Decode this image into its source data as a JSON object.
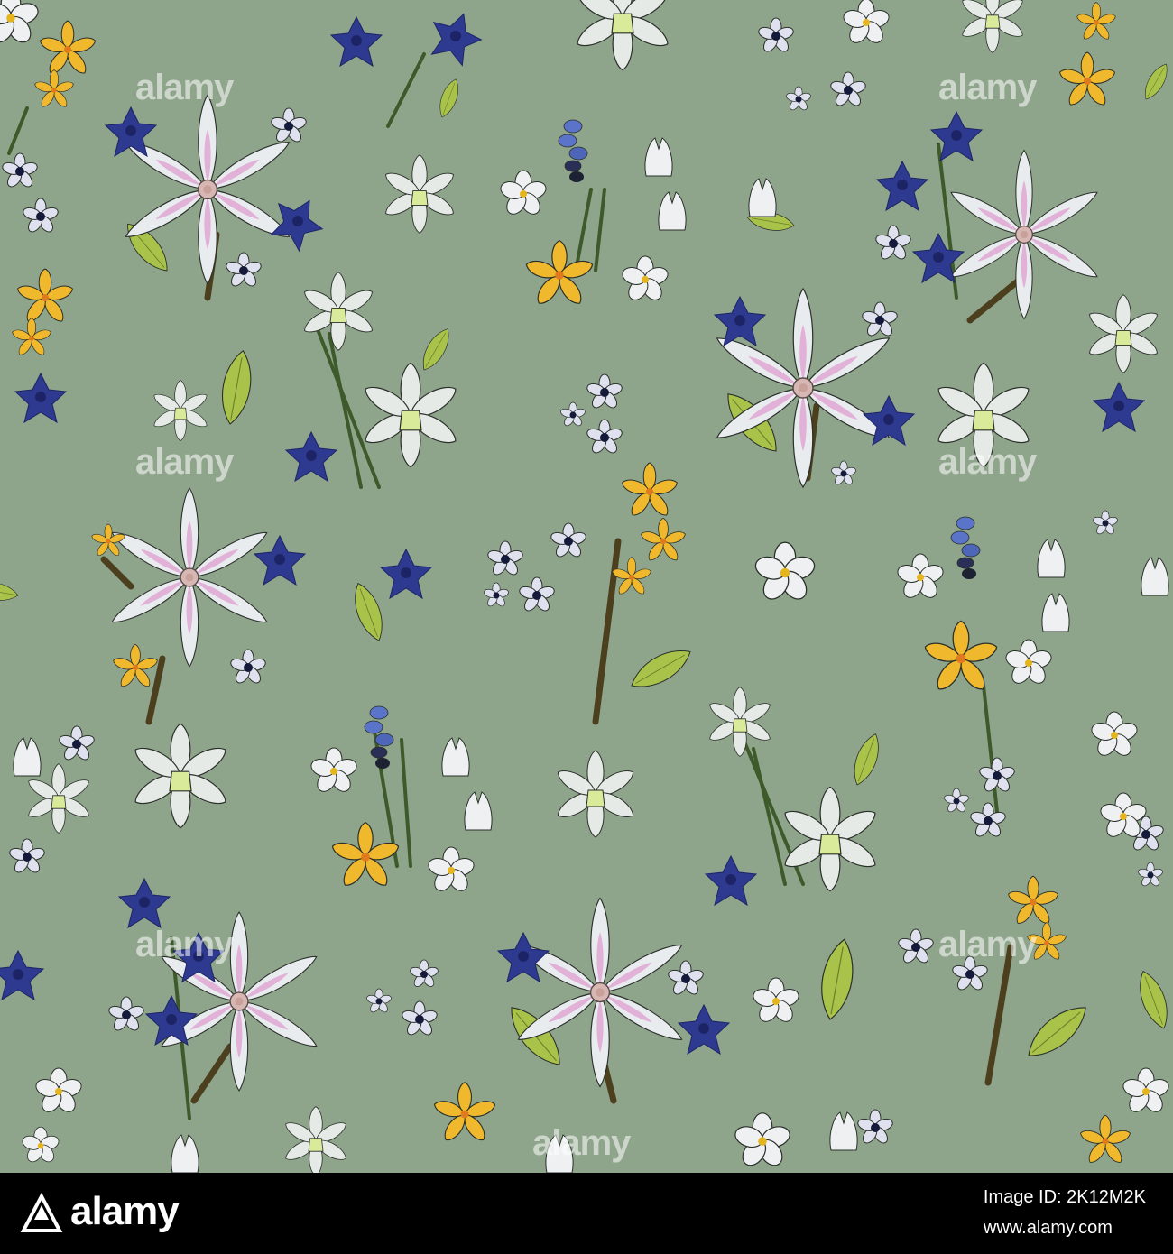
{
  "image": {
    "background_color": "#8ea58b",
    "subject": "seamless floral pattern"
  },
  "watermark": {
    "text": "alamy"
  },
  "footer": {
    "brand": "alamy",
    "image_id_line": "Image ID: 2K12M2K",
    "url": "www.alamy.com",
    "bar_color": "#000000",
    "text_color": "#ffffff"
  },
  "palette": {
    "petal_white": "#e8ecef",
    "petal_pink": "#e2a7d4",
    "blue_bell": "#2e3a8f",
    "hyacinth": "#5a74c9",
    "yellow": "#f0b82c",
    "leaf": "#a9c24a",
    "stem": "#3e5a2b",
    "branch": "#4b3f1e",
    "ink": "#2a2f2a"
  }
}
